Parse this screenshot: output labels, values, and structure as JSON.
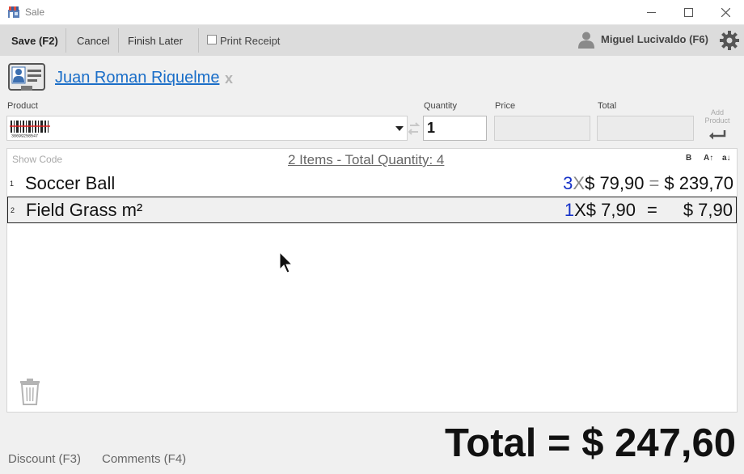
{
  "window": {
    "title": "Sale"
  },
  "toolbar": {
    "save_label": "Save (F2)",
    "cancel_label": "Cancel",
    "finish_later_label": "Finish Later",
    "print_receipt_label": "Print Receipt",
    "print_receipt_checked": false,
    "user_label": "Miguel Lucivaldo (F6)"
  },
  "customer": {
    "name": "Juan Roman Riquelme",
    "remove_symbol": "x"
  },
  "entry": {
    "product_label": "Product",
    "quantity_label": "Quantity",
    "quantity_value": "1",
    "price_label": "Price",
    "price_value": "",
    "total_label": "Total",
    "total_value": "",
    "add_product_label_line1": "Add",
    "add_product_label_line2": "Product"
  },
  "list": {
    "show_code_label": "Show Code",
    "summary": "2 Items - Total Quantity: 4",
    "format_buttons": [
      "B",
      "A↑",
      "a↓"
    ],
    "items": [
      {
        "num": "1",
        "name": "Soccer Ball",
        "qty": "3",
        "times": "X",
        "unit_price": "$ 79,90",
        "equals": "=",
        "total": "$ 239,70"
      },
      {
        "num": "2",
        "name": "Field Grass m²",
        "qty": "1",
        "times": "X",
        "unit_price": "$ 7,90",
        "equals": "=",
        "total": "$ 7,90"
      }
    ]
  },
  "footer": {
    "discount_label": "Discount (F3)",
    "comments_label": "Comments (F4)",
    "grand_total": "Total = $ 247,60"
  },
  "colors": {
    "link": "#1a6ec8",
    "qty": "#1733c8",
    "toolbar_bg": "#dcdcdc"
  },
  "icons": [
    "app-store-icon",
    "minimize-icon",
    "maximize-icon",
    "close-icon",
    "user-icon",
    "gear-icon",
    "customer-card-icon",
    "barcode-icon",
    "swap-icon",
    "enter-icon",
    "trash-icon",
    "cursor-icon"
  ]
}
